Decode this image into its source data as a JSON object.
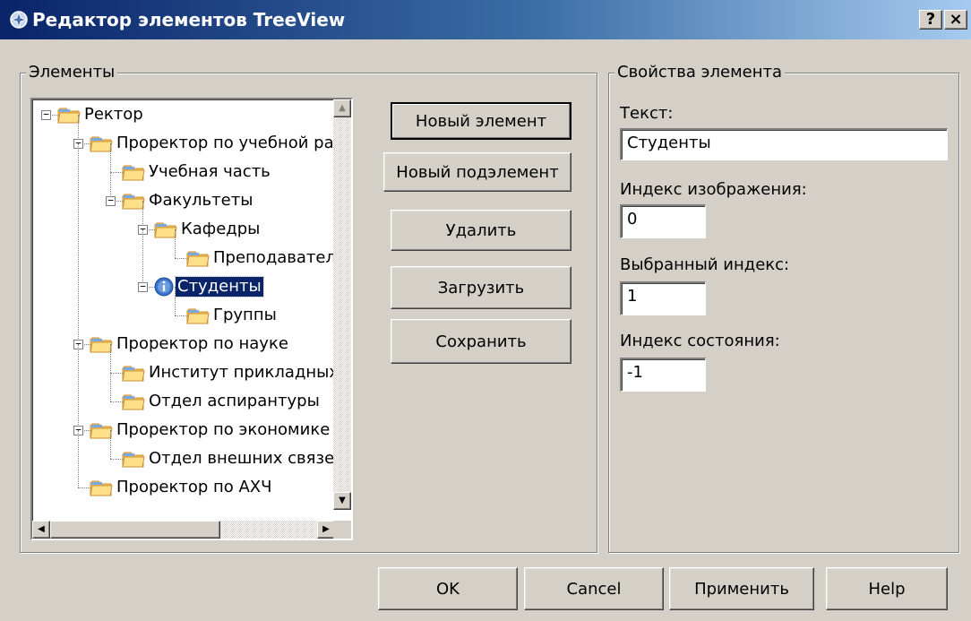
{
  "window": {
    "title": "Редактор элементов TreeView",
    "help_button": "?",
    "close_button": "×",
    "title_gradient": [
      "#0a246a",
      "#a6caf0"
    ]
  },
  "elements_group": {
    "legend": "Элементы",
    "tree": [
      {
        "label": "Ректор",
        "level": 0,
        "expanded": true,
        "icon": "folder-icon"
      },
      {
        "label": "Проректор по учебной ра",
        "level": 1,
        "expanded": true,
        "icon": "folder-icon"
      },
      {
        "label": "Учебная часть",
        "level": 2,
        "icon": "folder-icon"
      },
      {
        "label": "Факультеты",
        "level": 2,
        "expanded": true,
        "icon": "folder-icon"
      },
      {
        "label": "Кафедры",
        "level": 3,
        "expanded": true,
        "icon": "folder-icon"
      },
      {
        "label": "Преподаватели",
        "level": 4,
        "icon": "folder-icon"
      },
      {
        "label": "Студенты",
        "level": 3,
        "expanded": true,
        "icon": "info-icon",
        "selected": true
      },
      {
        "label": "Группы",
        "level": 4,
        "icon": "folder-icon"
      },
      {
        "label": "Проректор по науке",
        "level": 1,
        "expanded": true,
        "icon": "folder-icon"
      },
      {
        "label": "Институт прикладных",
        "level": 2,
        "icon": "folder-icon"
      },
      {
        "label": "Отдел аспирантуры",
        "level": 2,
        "icon": "folder-icon"
      },
      {
        "label": "Проректор по экономике",
        "level": 1,
        "expanded": true,
        "icon": "folder-icon"
      },
      {
        "label": "Отдел внешних связе",
        "level": 2,
        "icon": "folder-icon"
      },
      {
        "label": "Проректор по АХЧ",
        "level": 1,
        "icon": "folder-icon"
      }
    ],
    "buttons": {
      "new_element": "Новый элемент",
      "new_subelement": "Новый подэлемент",
      "delete": "Удалить",
      "load": "Загрузить",
      "save": "Сохранить"
    }
  },
  "properties_group": {
    "legend": "Свойства элемента",
    "text_label": "Текст:",
    "text_value": "Студенты",
    "image_index_label": "Индекс изображения:",
    "image_index_value": "0",
    "selected_index_label": "Выбранный индекс:",
    "selected_index_value": "1",
    "state_index_label": "Индекс состояния:",
    "state_index_value": "-1"
  },
  "footer": {
    "ok": "OK",
    "cancel": "Cancel",
    "apply": "Применить",
    "help": "Help"
  }
}
